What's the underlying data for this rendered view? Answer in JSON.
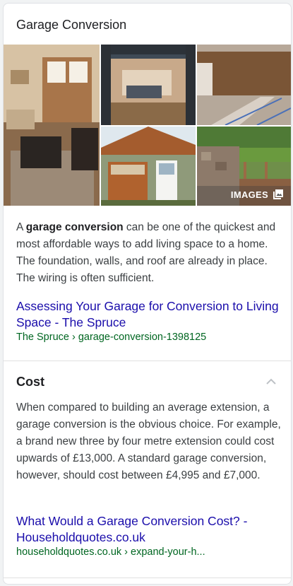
{
  "card": {
    "title": "Garage Conversion",
    "images_label": "IMAGES",
    "description": {
      "prefix": "A ",
      "bold": "garage conversion",
      "rest": " can be one of the quickest and most affordable ways to add living space to a home. The foundation, walls, and roof are already in place. The wiring is often sufficient."
    },
    "source_link": {
      "title": "Assessing Your Garage for Conversion to Living Space - The Spruce",
      "cite": "The Spruce › garage-conversion-1398125"
    },
    "section": {
      "title": "Cost",
      "text": "When compared to building an average extension, a garage conversion is the obvious choice. For example, a brand new three by four metre extension could cost upwards of £13,000. A standard garage conversion, however, should cost between £4,995 and £7,000.",
      "link_title": "What Would a Garage Conversion Cost? - Householdquotes.co.uk",
      "cite": "householdquotes.co.uk › expand-your-h..."
    }
  },
  "icons": {
    "images": "image-gallery-icon",
    "collapse": "chevron-up-icon"
  }
}
